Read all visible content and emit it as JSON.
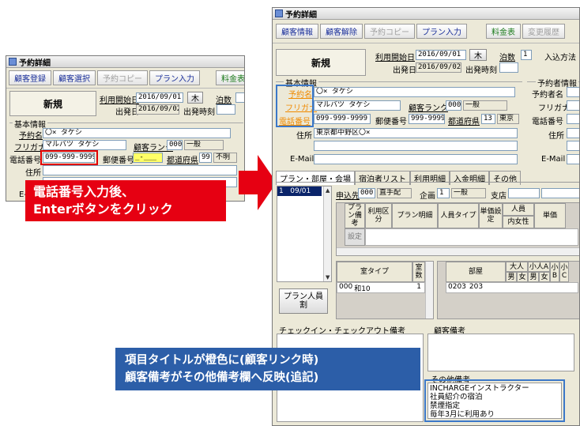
{
  "left_window": {
    "title": "予約詳細",
    "toolbar": [
      "顧客登録",
      "顧客選択",
      "予約コピー",
      "プラン入力",
      "料金表"
    ],
    "status": "新規",
    "start_date_label": "利用開始日",
    "start_date": "2016/09/01",
    "weekday": "木",
    "nights_label": "泊数",
    "depart_label": "出発日",
    "depart_date": "2016/09/02",
    "depart_time_label": "出発時刻",
    "section": "基本情報",
    "name_label": "予約名",
    "name_value": "〇× タケシ",
    "kana_label": "フリガナ",
    "kana_value": "マルバツ タケシ",
    "rank_label": "顧客ランク",
    "rank_code": "000",
    "rank_value": "一般",
    "phone_label": "電話番号",
    "phone_value": "099-999-9999",
    "zip_label": "郵便番号",
    "zip_value": "_-___",
    "pref_label": "都道府県",
    "pref_code": "99",
    "pref_value": "不明",
    "address_label": "住所",
    "email_label": "E-"
  },
  "right_window": {
    "title": "予約詳細",
    "toolbar": [
      "顧客情報",
      "顧客解除",
      "予約コピー",
      "プラン入力",
      "料金表",
      "変更履歴"
    ],
    "status": "新規",
    "start_date_label": "利用開始日",
    "start_date": "2016/09/01",
    "weekday": "木",
    "nights_label": "泊数",
    "nights_value": "1",
    "payment_label": "入込方法",
    "depart_label": "出発日",
    "depart_date": "2016/09/02",
    "depart_time_label": "出発時刻",
    "section": "基本情報",
    "booker_section": "予約者情報",
    "name_label": "予約名",
    "name_value": "〇× タケシ",
    "kana_label": "フリガナ",
    "kana_value": "マルバツ タケシ",
    "rank_label": "顧客ランク",
    "rank_code": "000",
    "rank_value": "一般",
    "phone_label": "電話番号",
    "phone_value": "099-999-9999",
    "zip_label": "郵便番号",
    "zip_value": "999-9999",
    "pref_label": "都道府県",
    "pref_code": "13",
    "pref_value": "東京",
    "address_label": "住所",
    "address_value": "東京都中野区〇×",
    "email_label": "E-Mail",
    "booker_name_label": "予約者名",
    "booker_kana_label": "フリガナ",
    "booker_phone_label": "電話番号",
    "booker_address_label": "住所",
    "booker_email_label": "E-Mail",
    "tabs": [
      "プラン・部屋・会場",
      "宿泊者リスト",
      "利用明細",
      "入金明細",
      "その他"
    ],
    "date_row": "1   09/01",
    "application_label": "申込先",
    "application_code": "000",
    "application_value": "直手配",
    "project_label": "企画",
    "project_code": "1",
    "project_value": "一般",
    "branch_label": "支店",
    "plan_headers": [
      "プラン備考",
      "利用区分",
      "プラン明細",
      "人員タイプ",
      "単価設定",
      "人員",
      "内女性",
      "単価"
    ],
    "plan_row_label": "設定",
    "room_headers": [
      "室タイプ",
      "室数",
      "部屋",
      "大人",
      "男",
      "女",
      "小人A",
      "男",
      "女",
      "小B",
      "小C"
    ],
    "room_type_code": "000",
    "room_type_value": "和10",
    "room_count": "1",
    "room_code": "0203",
    "room_value": "203",
    "plan_person_button": "プラン人員割",
    "checkin_notes_label": "チェックイン・チェックアウト備考",
    "customer_notes_label": "顧客備考",
    "other_notes_label": "その他備考",
    "other_notes_lines": [
      "INCHARGEインストラクター",
      "社員紹介の宿泊",
      "禁煙指定",
      "毎年3月に利用あり"
    ]
  },
  "callout_red": [
    "電話番号入力後、",
    "Enterボタンをクリック"
  ],
  "callout_blue": [
    "項目タイトルが橙色に(顧客リンク時)",
    "顧客備考がその他備考欄へ反映(追記)"
  ],
  "colors": {
    "red": "#e60012",
    "blue": "#2c5ea8",
    "orange_label": "#f08a00"
  }
}
